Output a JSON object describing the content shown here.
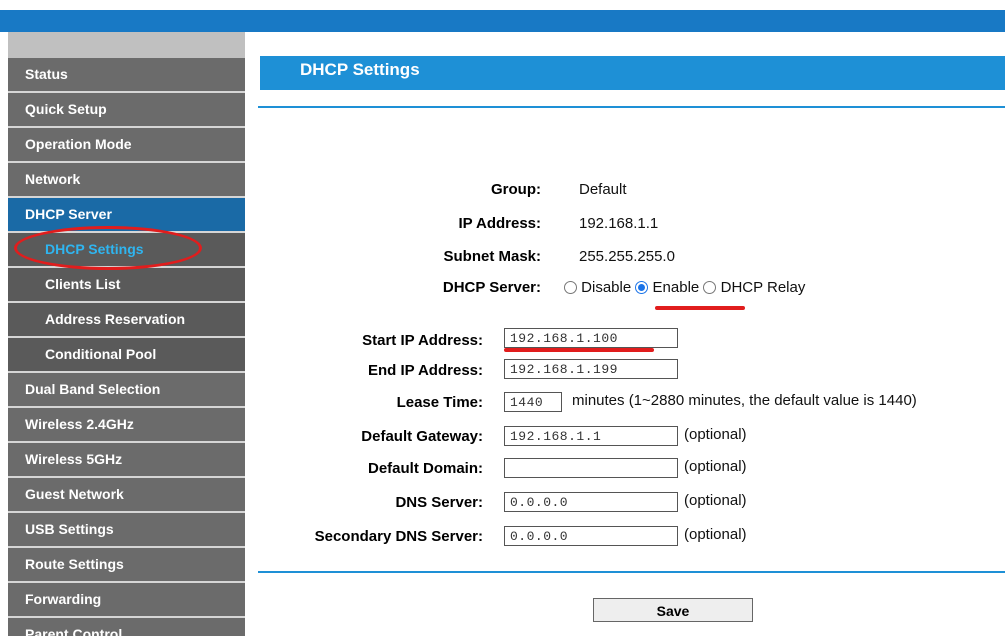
{
  "sidebar": {
    "items": [
      {
        "label": "Status"
      },
      {
        "label": "Quick Setup"
      },
      {
        "label": "Operation Mode"
      },
      {
        "label": "Network"
      },
      {
        "label": "DHCP Server"
      },
      {
        "label": "DHCP Settings"
      },
      {
        "label": "Clients List"
      },
      {
        "label": "Address Reservation"
      },
      {
        "label": "Conditional Pool"
      },
      {
        "label": "Dual Band Selection"
      },
      {
        "label": "Wireless 2.4GHz"
      },
      {
        "label": "Wireless 5GHz"
      },
      {
        "label": "Guest Network"
      },
      {
        "label": "USB Settings"
      },
      {
        "label": "Route Settings"
      },
      {
        "label": "Forwarding"
      },
      {
        "label": "Parent Control"
      }
    ]
  },
  "main": {
    "title": "DHCP Settings",
    "group_label": "Group:",
    "group_value": "Default",
    "ip_label": "IP Address:",
    "ip_value": "192.168.1.1",
    "mask_label": "Subnet Mask:",
    "mask_value": "255.255.255.0",
    "dhcp_server_label": "DHCP Server:",
    "dhcp_options": [
      "Disable",
      "Enable",
      "DHCP Relay"
    ],
    "dhcp_selected": "Enable",
    "start_label": "Start IP Address:",
    "start_value": "192.168.1.100",
    "end_label": "End IP Address:",
    "end_value": "192.168.1.199",
    "lease_label": "Lease Time:",
    "lease_value": "1440",
    "lease_hint": "minutes (1~2880 minutes, the default value is 1440)",
    "gateway_label": "Default Gateway:",
    "gateway_value": "192.168.1.1",
    "domain_label": "Default Domain:",
    "domain_value": "",
    "dns_label": "DNS Server:",
    "dns_value": "0.0.0.0",
    "dns2_label": "Secondary DNS Server:",
    "dns2_value": "0.0.0.0",
    "optional_text": "(optional)",
    "save_label": "Save"
  },
  "colors": {
    "accent": "#1e90d6",
    "highlight": "#e11d1d",
    "sidebar_bg": "#6b6b6b"
  }
}
